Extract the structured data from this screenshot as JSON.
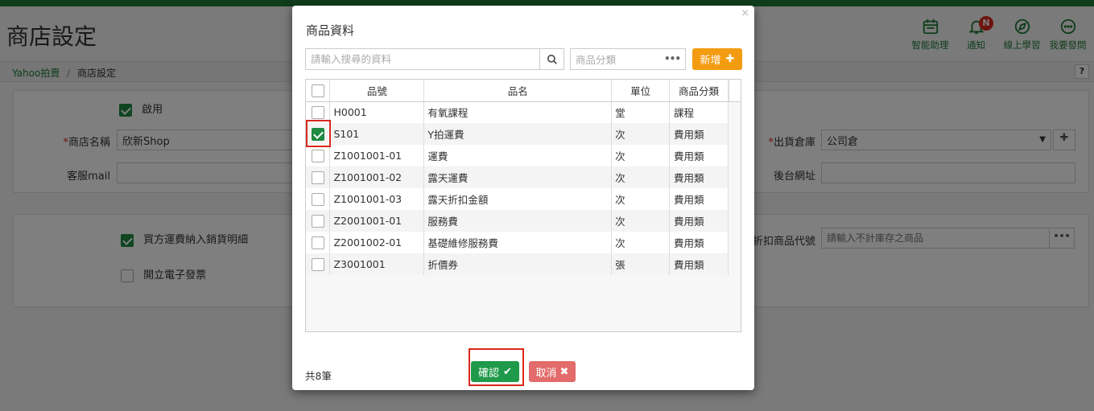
{
  "page": {
    "title": "商店設定",
    "breadcrumb": {
      "root": "Yahoo拍賣",
      "separator": "/",
      "current": "商店設定"
    },
    "help": "?",
    "top_icons": [
      {
        "name": "smart-assistant",
        "label": "智能助理"
      },
      {
        "name": "notification",
        "label": "通知",
        "badge": "N"
      },
      {
        "name": "online-learning",
        "label": "線上學習"
      },
      {
        "name": "ask-question",
        "label": "我要發問"
      }
    ],
    "settings": {
      "enabled_label": "啟用",
      "enabled": true,
      "shop_name_label": "商店名稱",
      "shop_name_value": "欣新Shop",
      "service_mail_label": "客服mail",
      "warehouse_label": "出貨倉庫",
      "warehouse_value": "公司倉",
      "backend_url_label": "後台網址",
      "buyer_shipping_label": "買方運費納入銷貨明細",
      "buyer_shipping": true,
      "invoice_label": "開立電子發票",
      "invoice": false,
      "discount_code_label": "折扣商品代號",
      "discount_code_placeholder": "請輸入不計庫存之商品"
    }
  },
  "modal": {
    "title": "商品資料",
    "close": "×",
    "search_placeholder": "請輸入搜尋的資料",
    "category_placeholder": "商品分類",
    "category_dots": "•••",
    "add_label": "新增",
    "columns": [
      "品號",
      "品名",
      "單位",
      "商品分類"
    ],
    "rows": [
      {
        "code": "H0001",
        "name": "有氧課程",
        "unit": "堂",
        "category": "課程",
        "checked": false
      },
      {
        "code": "S101",
        "name": "Y拍運費",
        "unit": "次",
        "category": "費用類",
        "checked": true
      },
      {
        "code": "Z1001001-01",
        "name": "運費",
        "unit": "次",
        "category": "費用類",
        "checked": false
      },
      {
        "code": "Z1001001-02",
        "name": "露天運費",
        "unit": "次",
        "category": "費用類",
        "checked": false
      },
      {
        "code": "Z1001001-03",
        "name": "露天折扣金額",
        "unit": "次",
        "category": "費用類",
        "checked": false
      },
      {
        "code": "Z2001001-01",
        "name": "服務費",
        "unit": "次",
        "category": "費用類",
        "checked": false
      },
      {
        "code": "Z2001002-01",
        "name": "基礎維修服務費",
        "unit": "次",
        "category": "費用類",
        "checked": false
      },
      {
        "code": "Z3001001",
        "name": "折價券",
        "unit": "張",
        "category": "費用類",
        "checked": false
      }
    ],
    "total": "共8筆",
    "confirm_label": "確認",
    "cancel_label": "取消"
  },
  "colors": {
    "brand": "#1f7a36",
    "confirm": "#1f9a4a",
    "cancel": "#e36b6b",
    "add": "#f39c12",
    "highlight": "#d9281c"
  }
}
